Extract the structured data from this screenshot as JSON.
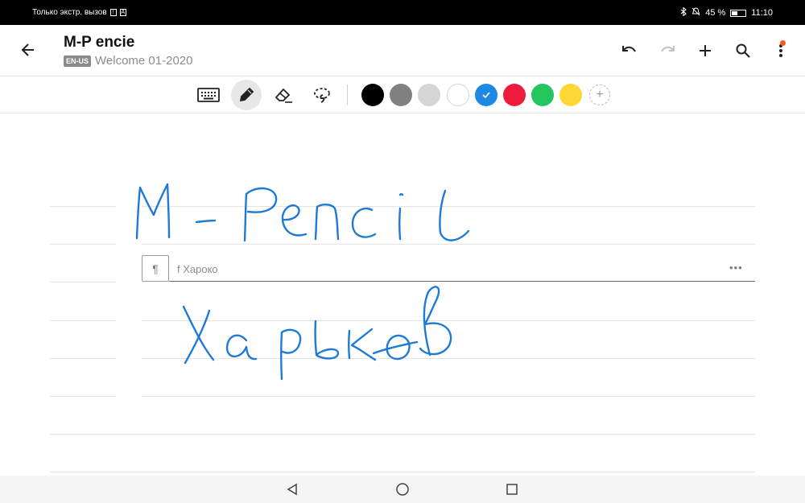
{
  "status_bar": {
    "carrier_text": "Только экстр. вызов",
    "battery_text": "45 %",
    "battery_level": 0.45,
    "time": "11:10"
  },
  "app_bar": {
    "title": "M-P encie",
    "language_badge": "EN-US",
    "subtitle": "Welcome 01-2020",
    "notification_dot_color": "#f25a1d"
  },
  "toolbar": {
    "tools": [
      {
        "name": "keyboard-icon",
        "active": false
      },
      {
        "name": "pen-icon",
        "active": true
      },
      {
        "name": "eraser-icon",
        "active": false
      },
      {
        "name": "lasso-icon",
        "active": false
      }
    ],
    "colors": [
      {
        "hex": "#000000",
        "selected": false
      },
      {
        "hex": "#808080",
        "selected": false
      },
      {
        "hex": "#d5d5d5",
        "selected": false
      },
      {
        "hex": "#ffffff",
        "selected": false
      },
      {
        "hex": "#1e88e5",
        "selected": true
      },
      {
        "hex": "#ee1c3c",
        "selected": false
      },
      {
        "hex": "#22c55e",
        "selected": false
      },
      {
        "hex": "#fdd835",
        "selected": false
      }
    ],
    "add_color_label": "+"
  },
  "note": {
    "paragraph_icon": "¶",
    "recognized_text": "f Хароко",
    "more_label": "•••",
    "ink_color": "#1f7ad6"
  }
}
